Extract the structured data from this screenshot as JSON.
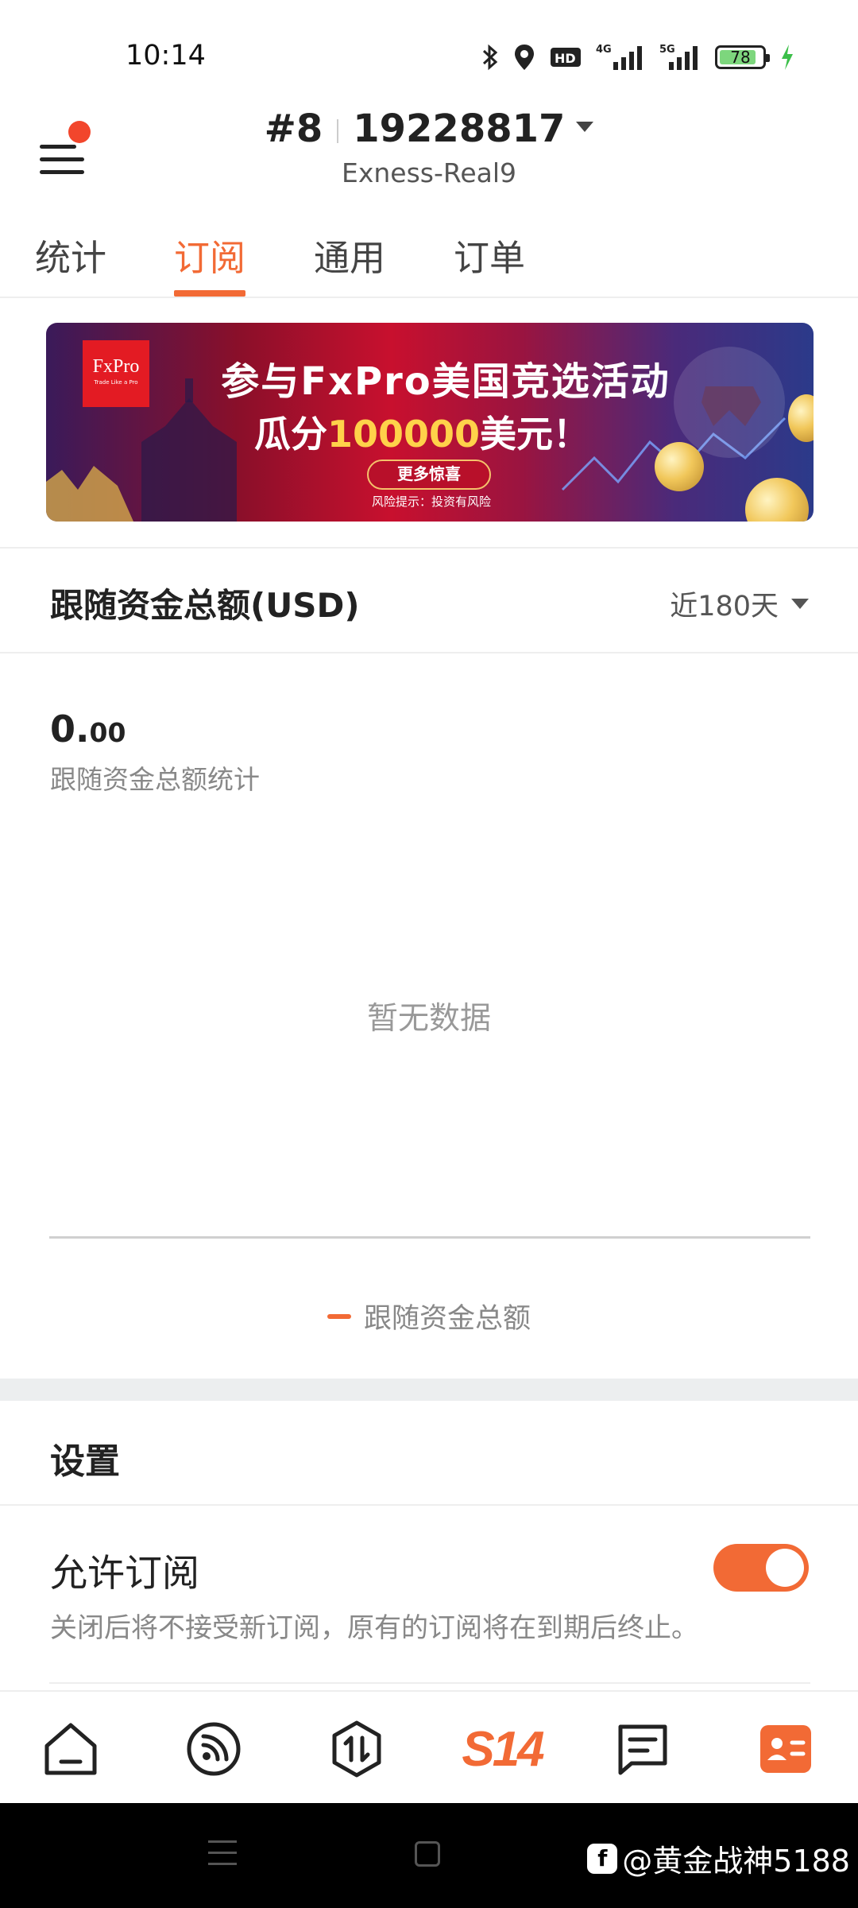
{
  "status_bar": {
    "time": "10:14",
    "battery_level": "78",
    "icons": [
      "bluetooth-icon",
      "location-icon",
      "hd-icon",
      "4g-signal-icon",
      "5g-signal-icon",
      "battery-icon",
      "charging-icon"
    ]
  },
  "header": {
    "account_number": "#8",
    "account_id": "19228817",
    "server": "Exness-Real9"
  },
  "tabs": [
    {
      "label": "统计",
      "active": false
    },
    {
      "label": "订阅",
      "active": true
    },
    {
      "label": "通用",
      "active": false
    },
    {
      "label": "订单",
      "active": false
    }
  ],
  "banner": {
    "logo_text": "FxPro",
    "logo_tagline": "Trade Like a Pro",
    "line1": "参与FxPro美国竞选活动",
    "line2_prefix": "瓜分",
    "line2_highlight": "100000",
    "line2_suffix": "美元！",
    "button": "更多惊喜",
    "risk": "风险提示：投资有风险"
  },
  "funds_card": {
    "title": "跟随资金总额(USD)",
    "range": "近180天",
    "value_int": "0.",
    "value_dec": "00",
    "value_desc": "跟随资金总额统计",
    "empty": "暂无数据",
    "legend": "跟随资金总额"
  },
  "chart_data": {
    "type": "line",
    "series": [
      {
        "name": "跟随资金总额",
        "values": []
      }
    ],
    "title": "跟随资金总额(USD)"
  },
  "settings": {
    "title": "设置",
    "allow_subscribe_label": "允许订阅",
    "allow_subscribe_desc": "关闭后将不接受新订阅，原有的订阅将在到期后终止。",
    "allow_subscribe_on": true
  },
  "bottom_nav": [
    {
      "icon": "home-icon"
    },
    {
      "icon": "signal-icon"
    },
    {
      "icon": "trade-icon"
    },
    {
      "label": "S14"
    },
    {
      "icon": "message-icon"
    },
    {
      "icon": "profile-card-icon",
      "active": true
    }
  ],
  "watermark": {
    "text": "@黄金战神5188"
  },
  "colors": {
    "accent": "#f26a35",
    "notification_dot": "#f2462c"
  }
}
